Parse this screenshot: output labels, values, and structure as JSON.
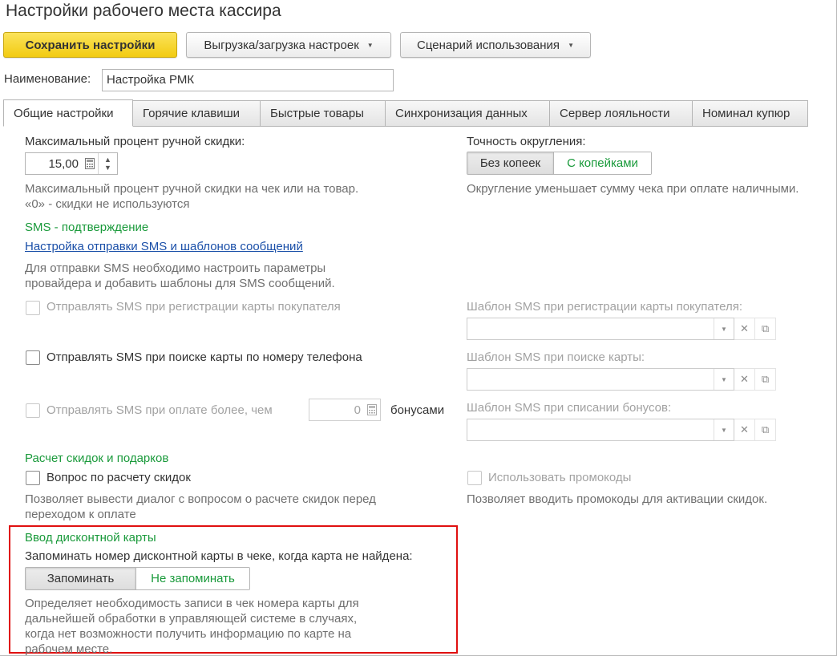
{
  "window": {
    "title": "Настройки рабочего места кассира"
  },
  "toolbar": {
    "save_label": "Сохранить настройки",
    "export_label": "Выгрузка/загрузка настроек",
    "scenario_label": "Сценарий использования"
  },
  "name_field": {
    "label": "Наименование:",
    "value": "Настройка РМК"
  },
  "tabs": [
    {
      "label": "Общие настройки",
      "active": true
    },
    {
      "label": "Горячие клавиши"
    },
    {
      "label": "Быстрые товары"
    },
    {
      "label": "Синхронизация данных"
    },
    {
      "label": "Сервер лояльности"
    },
    {
      "label": "Номинал купюр"
    }
  ],
  "discount": {
    "label": "Максимальный процент ручной скидки:",
    "value": "15,00",
    "hint_line1": "Максимальный процент ручной скидки на чек или на товар.",
    "hint_line2": "«0» - скидки не используются"
  },
  "rounding": {
    "label": "Точность округления:",
    "options": [
      "Без копеек",
      "С копейками"
    ],
    "selected": "С копейками",
    "hint": "Округление уменьшает сумму чека при оплате наличными."
  },
  "sms": {
    "section_title": "SMS - подтверждение",
    "link": "Настройка отправки SMS и шаблонов сообщений",
    "hint_line1": "Для отправки SMS необходимо настроить параметры",
    "hint_line2": "провайдера и добавить шаблоны для SMS сообщений.",
    "checkbox_registration": "Отправлять SMS при регистрации карты покупателя",
    "checkbox_phone_search": "Отправлять SMS при поиске карты по номеру телефона",
    "checkbox_payment": "Отправлять SMS при оплате более, чем",
    "payment_value": "0",
    "bonus_label": "бонусами",
    "template_registration_label": "Шаблон SMS при регистрации карты покупателя:",
    "template_search_label": "Шаблон SMS при поиске карты:",
    "template_bonus_label": "Шаблон SMS при списании бонусов:"
  },
  "discounts_calc": {
    "section_title": "Расчет скидок и подарков",
    "question_label": "Вопрос по расчету скидок",
    "question_hint_line1": "Позволяет вывести диалог с вопросом о расчете скидок перед",
    "question_hint_line2": "переходом к оплате",
    "promo_label": "Использовать промокоды",
    "promo_hint": "Позволяет вводить промокоды для активации скидок."
  },
  "card_input": {
    "section_title": "Ввод дисконтной карты",
    "question": "Запоминать номер дисконтной карты в чеке, когда карта не найдена:",
    "options": [
      "Запоминать",
      "Не запоминать"
    ],
    "selected": "Не запоминать",
    "hint_line1": "Определяет необходимость записи в чек номера карты для",
    "hint_line2": "дальнейшей обработки в управляющей системе в случаях,",
    "hint_line3": "когда нет возможности получить информацию по карте на",
    "hint_line4": "рабочем месте."
  },
  "colors": {
    "accent_green": "#1a9a3b",
    "save_yellow": "#f2cb12",
    "highlight_red": "#e01010",
    "link_blue": "#1a4fa8"
  }
}
